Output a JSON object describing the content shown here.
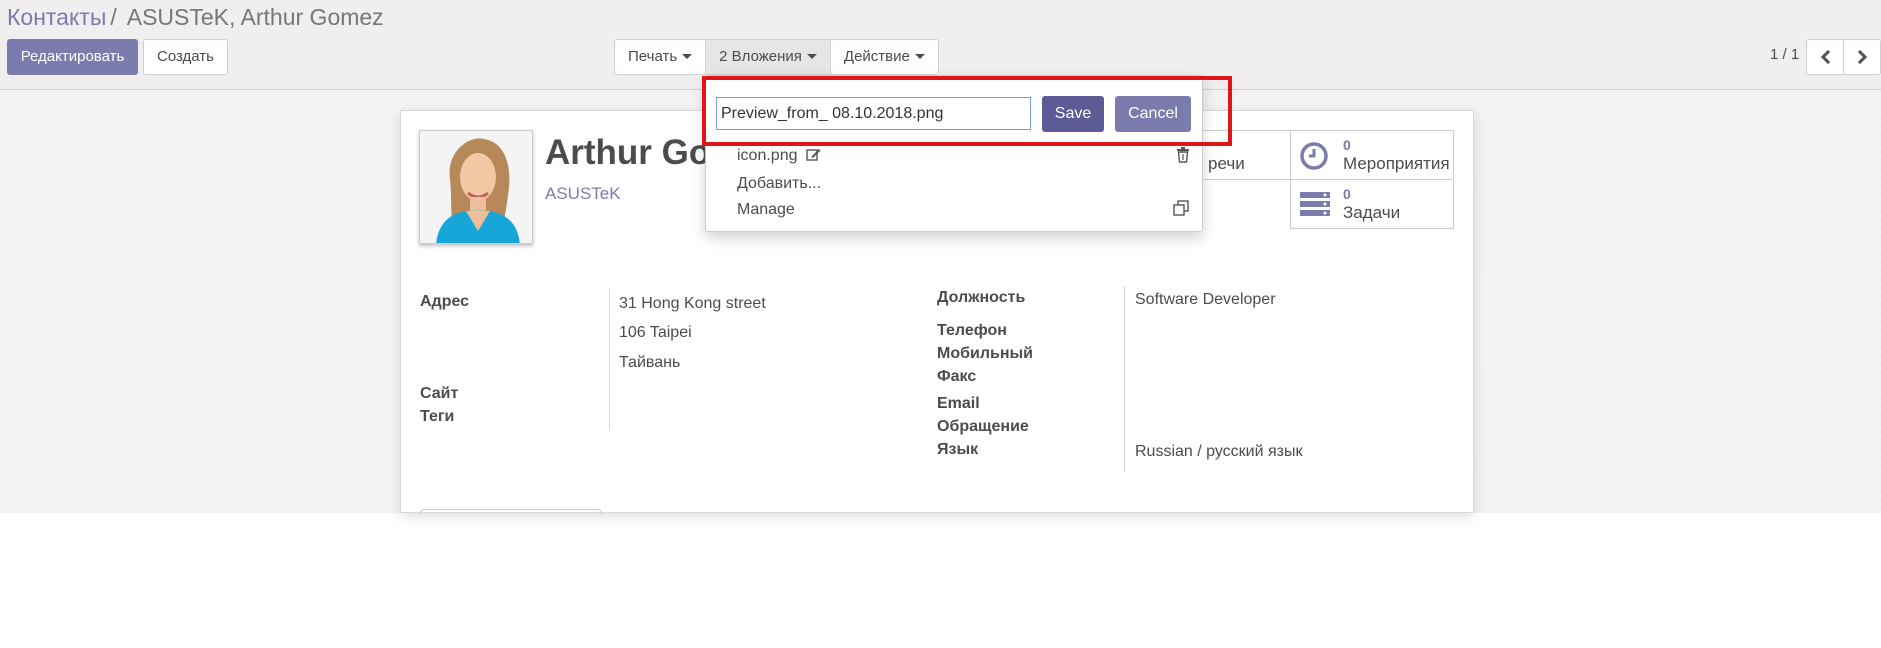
{
  "breadcrumb": {
    "parent": "Контакты",
    "separator": "/",
    "current": "ASUSTeK, Arthur Gomez"
  },
  "toolbar": {
    "edit_label": "Редактировать",
    "create_label": "Создать"
  },
  "sidebar_actions": {
    "print_label": "Печать",
    "attachments_label": "2 Вложения",
    "action_label": "Действие"
  },
  "pager": {
    "value": "1 / 1"
  },
  "contact": {
    "name": "Arthur Gomez",
    "company": "ASUSTeK"
  },
  "smart_buttons": {
    "meetings_partial_label": "речи",
    "events": {
      "count": "0",
      "label": "Мероприятия"
    },
    "tasks": {
      "count": "0",
      "label": "Задачи"
    }
  },
  "fields_left": {
    "address_label": "Адрес",
    "address_lines": [
      "31 Hong Kong street",
      "106 Taipei",
      "Тайвань"
    ],
    "website_label": "Сайт",
    "tags_label": "Теги"
  },
  "fields_right": {
    "job_label": "Должность",
    "job_value": "Software Developer",
    "phone_label": "Телефон",
    "mobile_label": "Мобильный",
    "fax_label": "Факс",
    "email_label": "Email",
    "title_label": "Обращение",
    "language_label": "Язык",
    "language_value": "Russian / русский язык"
  },
  "attachments_dropdown": {
    "rename_value": "Preview_from_ 08.10.2018.png",
    "save_label": "Save",
    "cancel_label": "Cancel",
    "items": [
      "icon.png",
      "Добавить...",
      "Manage"
    ]
  },
  "colors": {
    "brand": "#7c7bad",
    "save": "#5c5b95",
    "highlight": "#e0151c"
  }
}
